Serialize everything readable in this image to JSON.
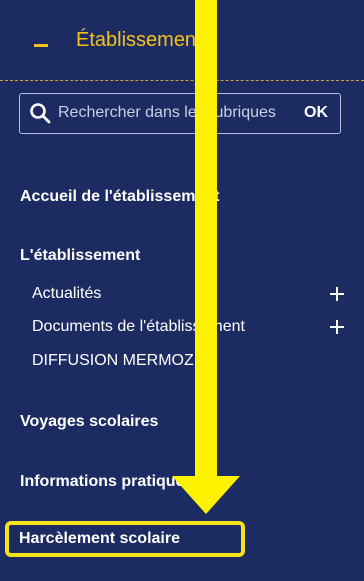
{
  "header": {
    "title": "Établissement",
    "toggle_icon": "minus-icon"
  },
  "search": {
    "placeholder": "Rechercher dans les rubriques",
    "button_label": "OK",
    "icon": "search-icon"
  },
  "nav": {
    "accueil": "Accueil de l'établissement",
    "etablissement": "L'établissement",
    "actualites": "Actualités",
    "documents": "Documents de l'établissement",
    "diffusion": "DIFFUSION MERMOZ",
    "voyages": "Voyages scolaires",
    "informations": "Informations pratiques",
    "harcelement": "Harcèlement scolaire"
  },
  "colors": {
    "background": "#1d2b63",
    "accent": "#f4c21a",
    "highlight": "#f4e21a"
  }
}
